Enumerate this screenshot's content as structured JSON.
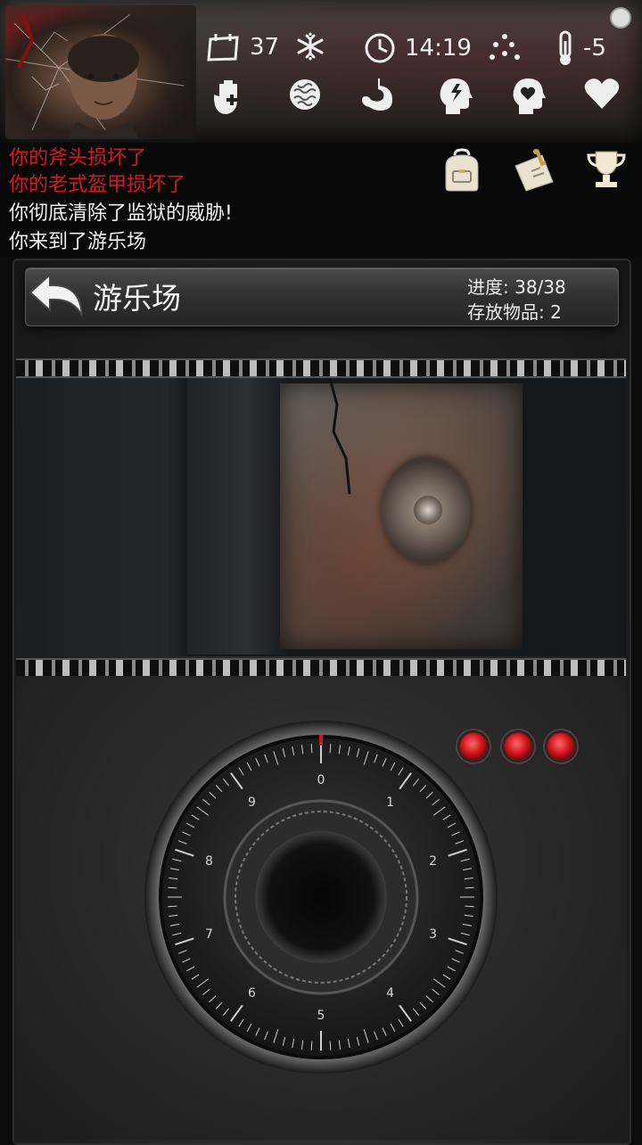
{
  "status": {
    "day": "37",
    "time": "14:19",
    "temperature": "-5",
    "season_icon": "snowflake-icon"
  },
  "needs_icons": [
    "hand-health-icon",
    "brain-icon",
    "stomach-icon",
    "energy-head-icon",
    "mood-head-icon",
    "heart-icon"
  ],
  "log": {
    "lines": [
      {
        "text": "你的斧头损坏了",
        "color": "#d8191c"
      },
      {
        "text": "你的老式盔甲损坏了",
        "color": "#d8191c"
      },
      {
        "text": "你彻底清除了监狱的威胁!",
        "color": "#f2f2f2"
      },
      {
        "text": "你来到了游乐场",
        "color": "#f2f2f2"
      }
    ]
  },
  "menu_icons": [
    "backpack-icon",
    "notes-icon",
    "trophy-icon"
  ],
  "location": {
    "name": "游乐场",
    "progress_label": "进度:",
    "progress_value": "38/38",
    "storage_label": "存放物品:",
    "storage_value": "2"
  },
  "lock": {
    "indicator_count": 3,
    "indicator_color": "#d0161c",
    "dial_numbers": [
      "0",
      "1",
      "2",
      "3",
      "4",
      "5",
      "6",
      "7",
      "8",
      "9"
    ]
  }
}
